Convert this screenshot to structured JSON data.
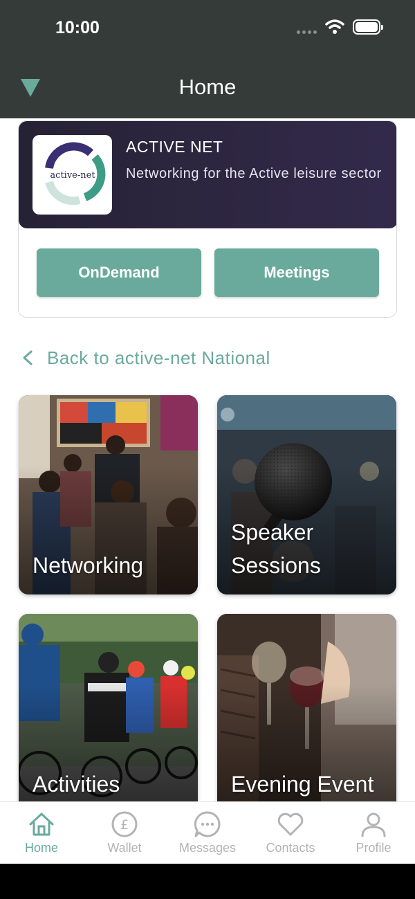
{
  "status": {
    "time": "10:00"
  },
  "header": {
    "title": "Home"
  },
  "org": {
    "name": "ACTIVE NET",
    "description": "Networking for the Active leisure sector",
    "logo_text": "active-net"
  },
  "buttons": {
    "ondemand": "OnDemand",
    "meetings": "Meetings"
  },
  "back_link": {
    "label": "Back to active-net National"
  },
  "tiles": [
    {
      "label": "Networking"
    },
    {
      "label_line1": "Speaker",
      "label_line2": "Sessions"
    },
    {
      "label": "Activities"
    },
    {
      "label": "Evening Event"
    }
  ],
  "nav": {
    "items": [
      {
        "label": "Home",
        "icon": "home-icon"
      },
      {
        "label": "Wallet",
        "icon": "pound-icon"
      },
      {
        "label": "Messages",
        "icon": "chat-icon"
      },
      {
        "label": "Contacts",
        "icon": "heart-icon"
      },
      {
        "label": "Profile",
        "icon": "person-icon"
      }
    ],
    "active": "Home"
  },
  "colors": {
    "accent": "#6aaa9c",
    "header": "#353b39",
    "banner": "#2b2540"
  }
}
